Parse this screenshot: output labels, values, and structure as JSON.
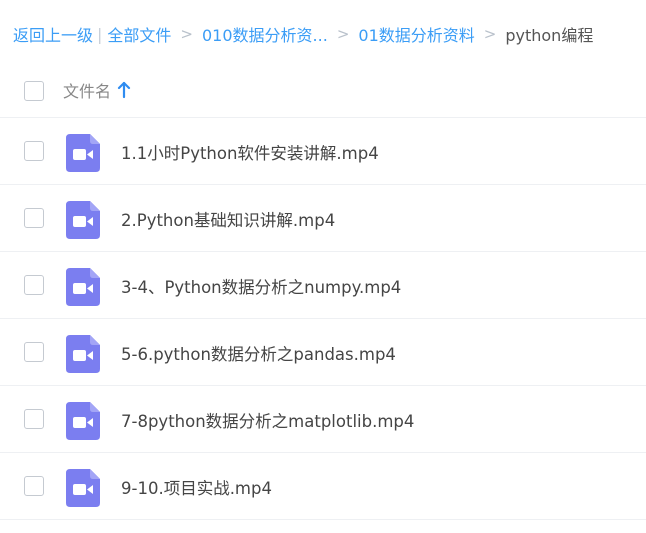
{
  "breadcrumb": {
    "back": "返回上一级",
    "all_files": "全部文件",
    "crumbs": [
      "010数据分析资...",
      "01数据分析资料"
    ],
    "current": "python编程"
  },
  "list_header": {
    "column_name": "文件名"
  },
  "files": [
    {
      "name": "1.1小时Python软件安装讲解.mp4",
      "icon": "video-file-icon"
    },
    {
      "name": "2.Python基础知识讲解.mp4",
      "icon": "video-file-icon"
    },
    {
      "name": "3-4、Python数据分析之numpy.mp4",
      "icon": "video-file-icon"
    },
    {
      "name": "5-6.python数据分析之pandas.mp4",
      "icon": "video-file-icon"
    },
    {
      "name": "7-8python数据分析之matplotlib.mp4",
      "icon": "video-file-icon"
    },
    {
      "name": "9-10.项目实战.mp4",
      "icon": "video-file-icon"
    }
  ],
  "colors": {
    "link": "#3b9df6",
    "video_icon": "#7b7ef0",
    "sort_arrow": "#2f8cf0"
  }
}
